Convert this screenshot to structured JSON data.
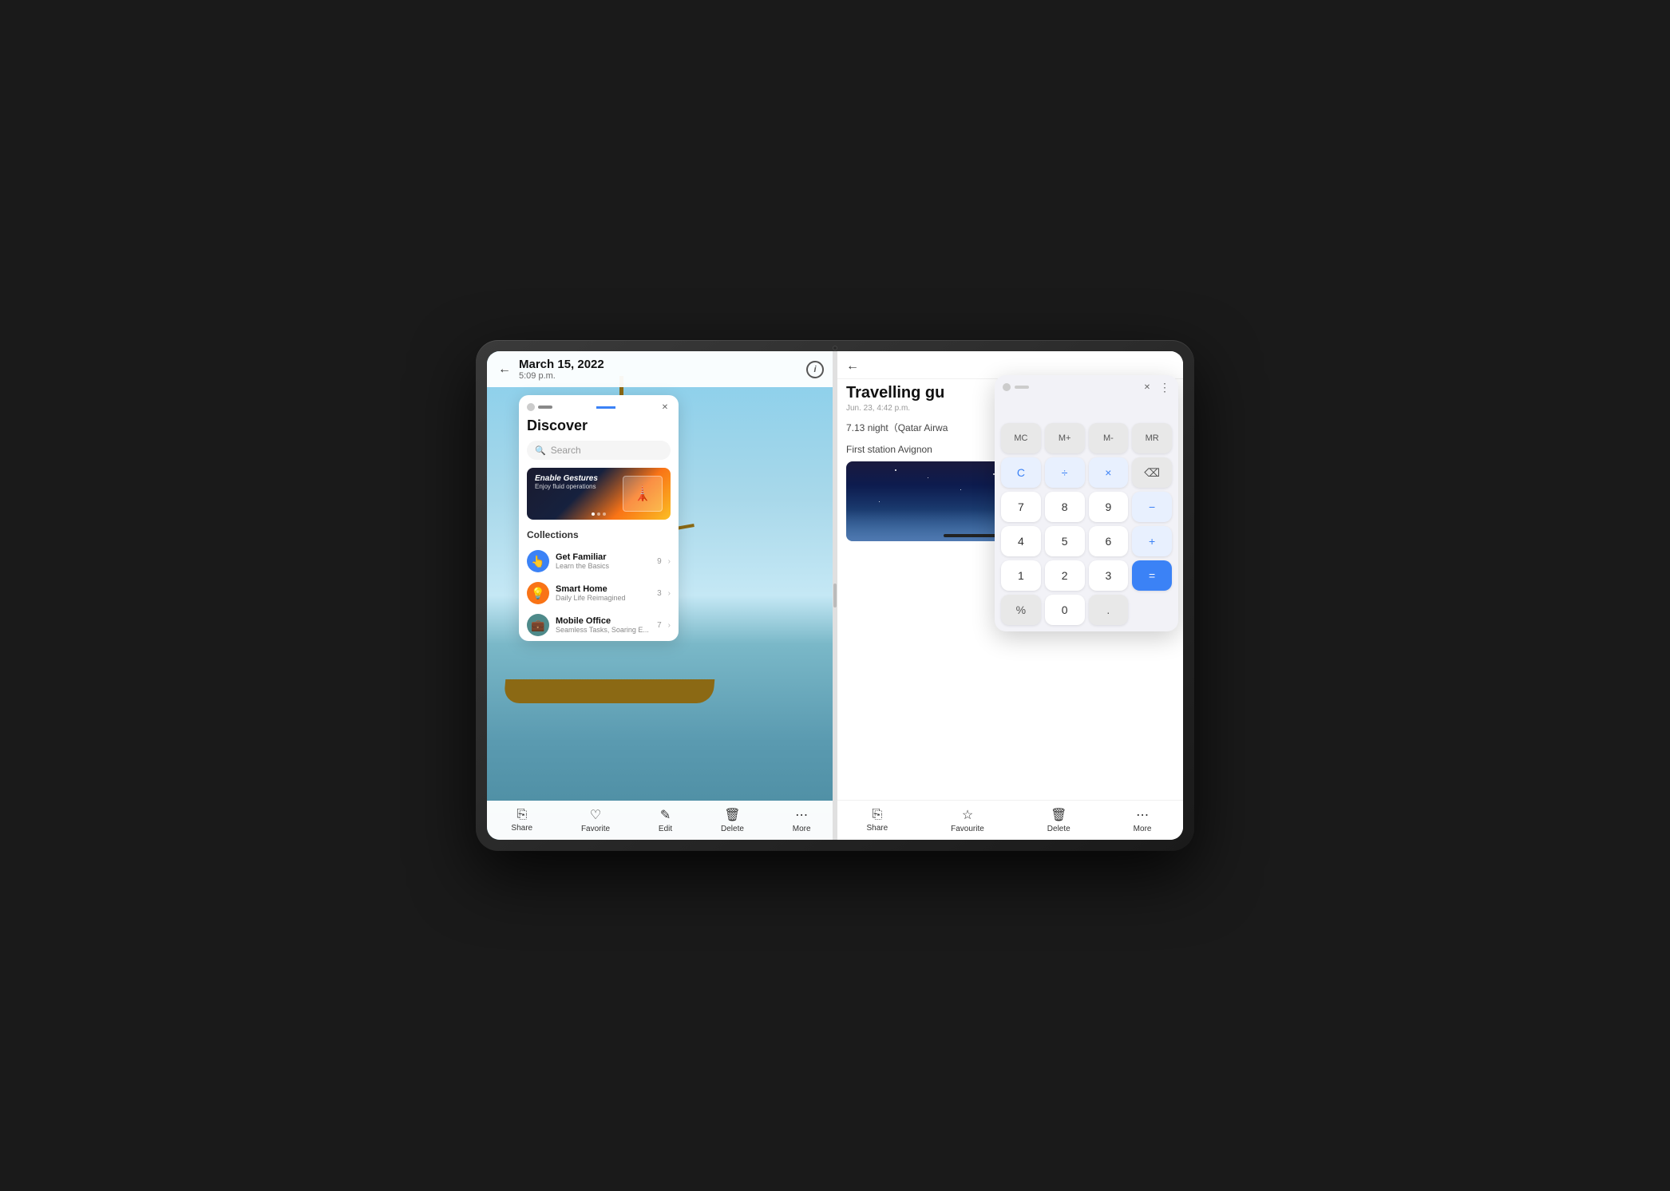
{
  "tablet": {
    "camera_alt": "front camera"
  },
  "left_panel": {
    "topbar": {
      "back_label": "←",
      "title": "March 15, 2022",
      "date": "5:09 p.m.",
      "info_label": "i"
    },
    "bottom_actions": [
      {
        "id": "share",
        "label": "Share",
        "icon": "⎘"
      },
      {
        "id": "favorite",
        "label": "Favorite",
        "icon": "♡"
      },
      {
        "id": "edit",
        "label": "Edit",
        "icon": "✎"
      },
      {
        "id": "delete",
        "label": "Delete",
        "icon": "⊡"
      },
      {
        "id": "more",
        "label": "More",
        "icon": "⋯"
      }
    ]
  },
  "discover": {
    "title": "Discover",
    "search_placeholder": "Search",
    "banner": {
      "title": "Enable Gestures",
      "subtitle": "Enjoy fluid operations"
    },
    "collections_label": "Collections",
    "items": [
      {
        "id": "get-familiar",
        "name": "Get Familiar",
        "desc": "Learn the Basics",
        "count": "9",
        "icon": "👆",
        "icon_color": "blue"
      },
      {
        "id": "smart-home",
        "name": "Smart Home",
        "desc": "Daily Life Reimagined",
        "count": "3",
        "icon": "💡",
        "icon_color": "orange"
      },
      {
        "id": "mobile-office",
        "name": "Mobile Office",
        "desc": "Seamless Tasks, Soaring E...",
        "count": "7",
        "icon": "💼",
        "icon_color": "teal"
      }
    ]
  },
  "right_panel": {
    "topbar": {
      "back_label": "←"
    },
    "note": {
      "title": "Travelling gu",
      "date": "Jun. 23, 4:42 p.m.",
      "line1": "7.13 night（Qatar Airwa",
      "line2": "First station  Avignon"
    },
    "bottom_actions": [
      {
        "id": "share",
        "label": "Share",
        "icon": "⎘"
      },
      {
        "id": "favourite",
        "label": "Favourite",
        "icon": "☆"
      },
      {
        "id": "delete",
        "label": "Delete",
        "icon": "⊡"
      },
      {
        "id": "more",
        "label": "More",
        "icon": "⋯"
      }
    ]
  },
  "calculator": {
    "display": "",
    "buttons": [
      {
        "label": "MC",
        "type": "memory"
      },
      {
        "label": "M+",
        "type": "memory"
      },
      {
        "label": "M-",
        "type": "memory"
      },
      {
        "label": "MR",
        "type": "memory"
      },
      {
        "label": "C",
        "type": "operator"
      },
      {
        "label": "÷",
        "type": "operator"
      },
      {
        "label": "×",
        "type": "operator"
      },
      {
        "label": "⌫",
        "type": "backspace"
      },
      {
        "label": "7",
        "type": "number"
      },
      {
        "label": "8",
        "type": "number"
      },
      {
        "label": "9",
        "type": "number"
      },
      {
        "label": "−",
        "type": "operator"
      },
      {
        "label": "4",
        "type": "number"
      },
      {
        "label": "5",
        "type": "number"
      },
      {
        "label": "6",
        "type": "number"
      },
      {
        "label": "+",
        "type": "operator"
      },
      {
        "label": "1",
        "type": "number"
      },
      {
        "label": "2",
        "type": "number"
      },
      {
        "label": "3",
        "type": "number"
      },
      {
        "label": "=",
        "type": "equals"
      },
      {
        "label": "%",
        "type": "special"
      },
      {
        "label": "0",
        "type": "number"
      },
      {
        "label": ".",
        "type": "special"
      }
    ]
  }
}
